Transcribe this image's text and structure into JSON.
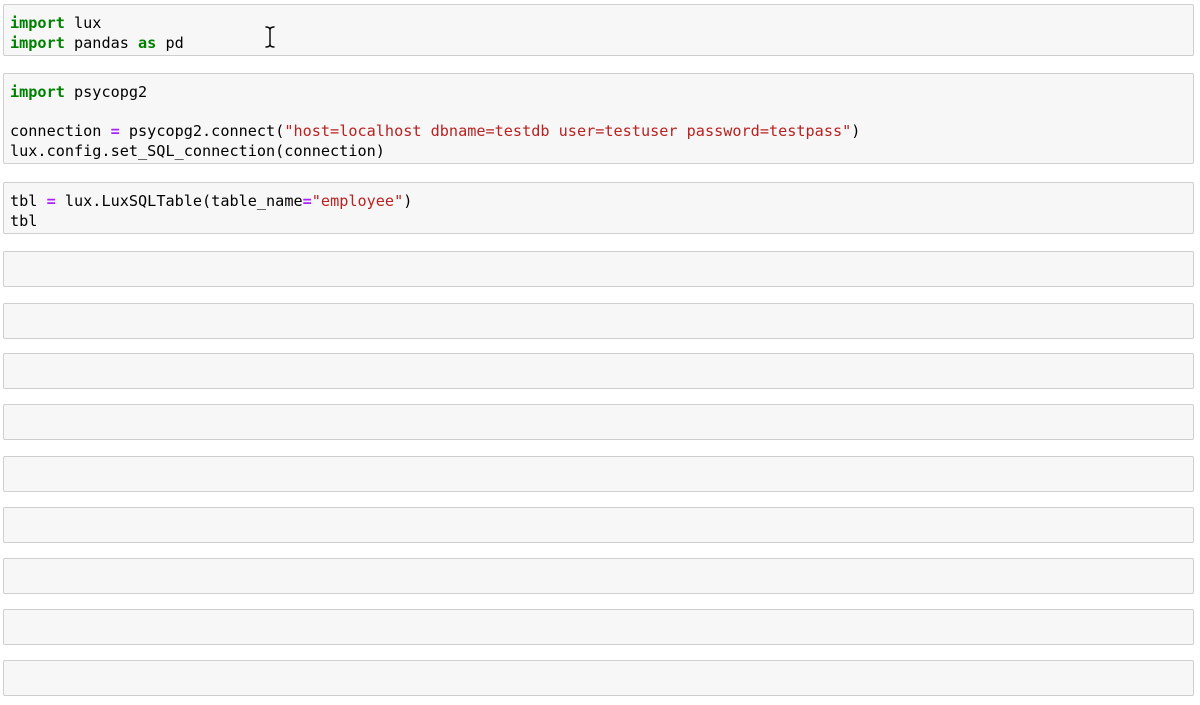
{
  "notebook": {
    "cells": [
      {
        "lines": [
          [
            {
              "t": "import",
              "c": "kw"
            },
            {
              "t": " lux",
              "c": ""
            }
          ],
          [
            {
              "t": "import",
              "c": "kw"
            },
            {
              "t": " pandas ",
              "c": ""
            },
            {
              "t": "as",
              "c": "kw"
            },
            {
              "t": " pd",
              "c": ""
            }
          ]
        ]
      },
      {
        "lines": [
          [
            {
              "t": "import",
              "c": "kw"
            },
            {
              "t": " psycopg2",
              "c": ""
            }
          ],
          [
            {
              "t": "",
              "c": ""
            }
          ],
          [
            {
              "t": "connection ",
              "c": ""
            },
            {
              "t": "=",
              "c": "op"
            },
            {
              "t": " psycopg2.connect(",
              "c": ""
            },
            {
              "t": "\"host=localhost dbname=testdb user=testuser password=testpass\"",
              "c": "str"
            },
            {
              "t": ")",
              "c": ""
            }
          ],
          [
            {
              "t": "lux.config.set_SQL_connection(connection)",
              "c": ""
            }
          ]
        ]
      },
      {
        "lines": [
          [
            {
              "t": "tbl ",
              "c": ""
            },
            {
              "t": "=",
              "c": "op"
            },
            {
              "t": " lux.LuxSQLTable(table_name",
              "c": ""
            },
            {
              "t": "=",
              "c": "op"
            },
            {
              "t": "\"employee\"",
              "c": "str"
            },
            {
              "t": ")",
              "c": ""
            }
          ],
          [
            {
              "t": "tbl",
              "c": ""
            }
          ]
        ]
      },
      {
        "lines": []
      },
      {
        "lines": []
      },
      {
        "lines": []
      },
      {
        "lines": []
      },
      {
        "lines": []
      },
      {
        "lines": []
      },
      {
        "lines": []
      },
      {
        "lines": []
      },
      {
        "lines": []
      }
    ]
  },
  "icons": {
    "cursor": "text-cursor-icon"
  },
  "colors": {
    "keyword": "#008000",
    "operator": "#aa22ff",
    "string": "#ba2121",
    "cell_background": "#f7f7f7",
    "cell_border": "#cfcfcf"
  }
}
